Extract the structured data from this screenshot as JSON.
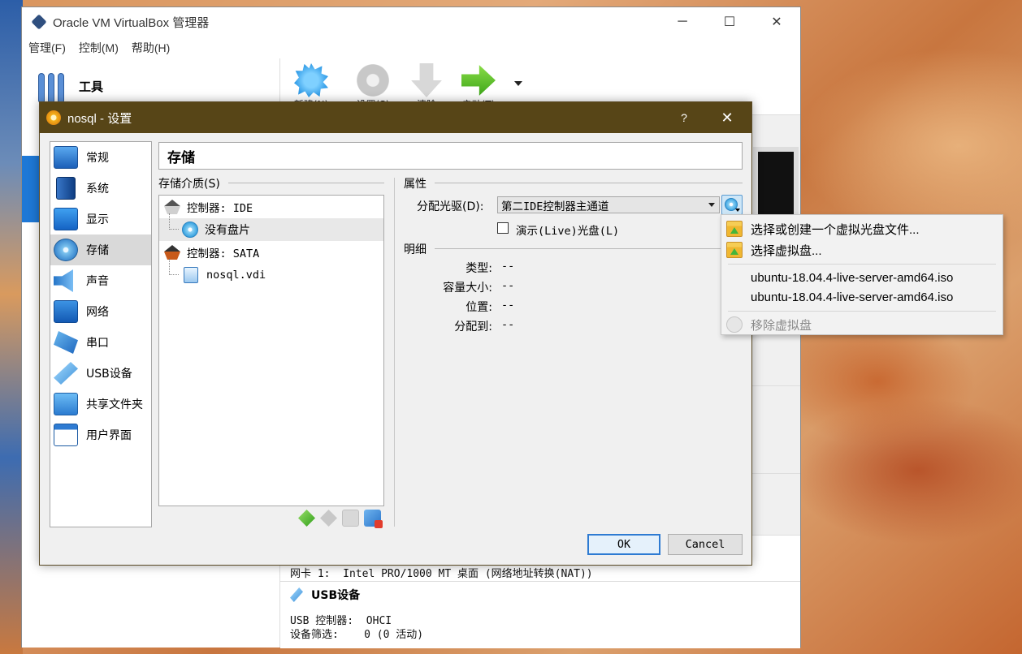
{
  "main_window": {
    "title": "Oracle VM VirtualBox 管理器",
    "menu": [
      "管理(F)",
      "控制(M)",
      "帮助(H)"
    ],
    "tools_label": "工具",
    "toolbar": [
      {
        "label": "新建(N)",
        "icon": "new-star-icon"
      },
      {
        "label": "设置(S)",
        "icon": "gear-icon"
      },
      {
        "label": "清除",
        "icon": "discard-arrow-icon"
      },
      {
        "label": "启动(T)",
        "icon": "start-arrow-icon"
      }
    ],
    "network_line": "网卡 1:  Intel PRO/1000 MT 桌面 (网络地址转换(NAT))",
    "usb_heading": "USB设备",
    "usb_controller_line": "USB 控制器:  OHCI",
    "usb_filter_line": "设备筛选:    0 (0 活动)"
  },
  "dialog": {
    "title": "nosql - 设置",
    "help": "?",
    "close": "✕",
    "sidebar": [
      {
        "label": "常规",
        "icon": "general-icon"
      },
      {
        "label": "系统",
        "icon": "system-icon"
      },
      {
        "label": "显示",
        "icon": "display-icon"
      },
      {
        "label": "存储",
        "icon": "storage-icon",
        "selected": true
      },
      {
        "label": "声音",
        "icon": "audio-icon"
      },
      {
        "label": "网络",
        "icon": "network-icon"
      },
      {
        "label": "串口",
        "icon": "serial-port-icon"
      },
      {
        "label": "USB设备",
        "icon": "usb-icon"
      },
      {
        "label": "共享文件夹",
        "icon": "shared-folder-icon"
      },
      {
        "label": "用户界面",
        "icon": "user-interface-icon"
      }
    ],
    "page_title": "存储",
    "storage_media_label": "存储介质(S)",
    "tree": [
      {
        "label": "控制器: IDE",
        "type": "controller-ide"
      },
      {
        "label": "没有盘片",
        "type": "optical-empty",
        "selected": true
      },
      {
        "label": "控制器: SATA",
        "type": "controller-sata"
      },
      {
        "label": "nosql.vdi",
        "type": "hard-disk"
      }
    ],
    "attributes_label": "属性",
    "optical_drive_label": "分配光驱(D):",
    "optical_drive_value": "第二IDE控制器主通道",
    "live_cd_label": "演示(Live)光盘(L)",
    "live_cd_checked": false,
    "details_label": "明细",
    "details": [
      {
        "key": "类型:",
        "value": "--"
      },
      {
        "key": "容量大小:",
        "value": "--"
      },
      {
        "key": "位置:",
        "value": "--"
      },
      {
        "key": "分配到:",
        "value": "--"
      }
    ],
    "ok_label": "OK",
    "cancel_label": "Cancel"
  },
  "popup_menu": {
    "items": [
      {
        "label": "选择或创建一个虚拟光盘文件...",
        "icon": "folder-add-icon",
        "enabled": true
      },
      {
        "label": "选择虚拟盘...",
        "icon": "folder-open-icon",
        "enabled": true
      },
      {
        "label": "ubuntu-18.04.4-live-server-amd64.iso",
        "enabled": true
      },
      {
        "label": "ubuntu-18.04.4-live-server-amd64.iso",
        "enabled": true
      },
      {
        "label": "移除虚拟盘",
        "icon": "remove-disc-icon",
        "enabled": false
      }
    ]
  }
}
